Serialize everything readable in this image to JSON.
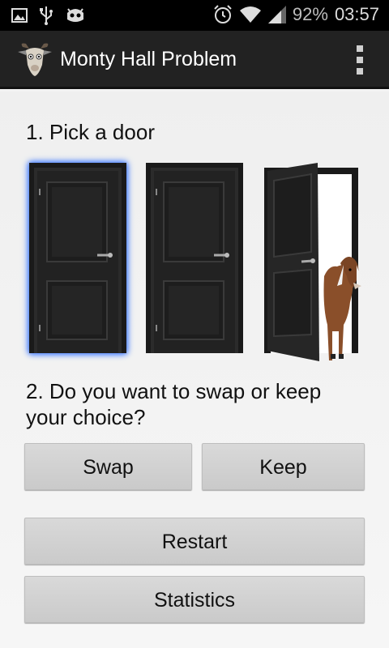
{
  "status_bar": {
    "battery": "92%",
    "time": "03:57",
    "icons": [
      "image-icon",
      "usb-icon",
      "android-debug-icon",
      "alarm-icon",
      "wifi-icon",
      "signal-icon"
    ]
  },
  "action_bar": {
    "title": "Monty Hall Problem",
    "icon": "goat-icon",
    "menu_icon": "overflow-menu-icon"
  },
  "steps": {
    "pick": "1. Pick a door",
    "decide": "2. Do you want to swap or keep your choice?"
  },
  "doors": [
    {
      "state": "closed",
      "selected": true
    },
    {
      "state": "closed",
      "selected": false
    },
    {
      "state": "open",
      "selected": false,
      "reveals": "goat"
    }
  ],
  "buttons": {
    "swap": "Swap",
    "keep": "Keep",
    "restart": "Restart",
    "statistics": "Statistics"
  },
  "colors": {
    "selection_glow": "#5b8cff",
    "action_bar": "#222222",
    "button": "#d2d2d2"
  }
}
